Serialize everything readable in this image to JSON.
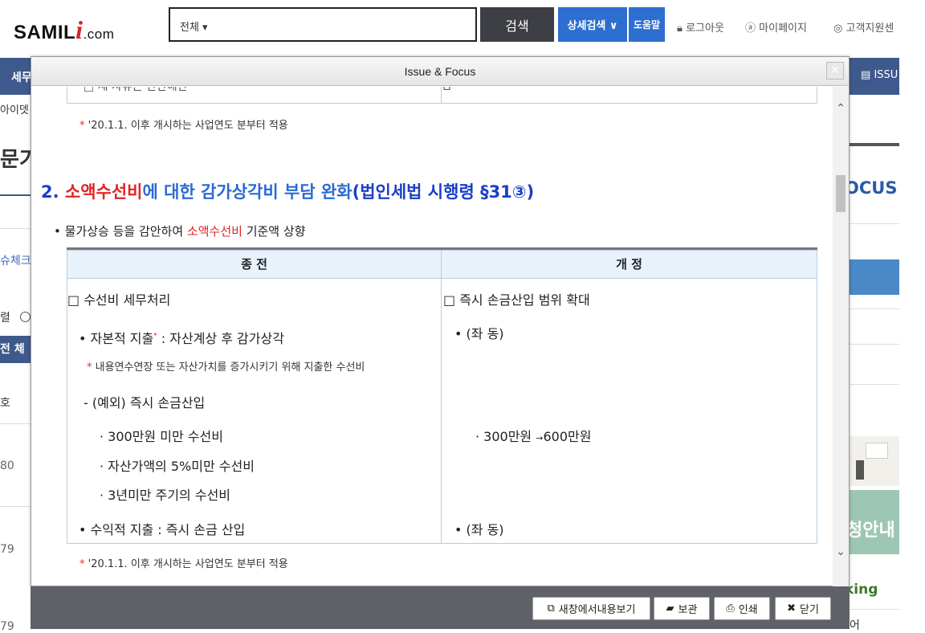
{
  "header": {
    "logo_main": "SAMIL",
    "logo_i": "i",
    "logo_dot": ".com",
    "scope": "전체 ▾",
    "search_label": "검색",
    "advanced_label": "상세검색 ∨",
    "help_label": "도움말",
    "links": [
      "로그아웃",
      "마이페이지",
      "고객지원센"
    ]
  },
  "nav": {
    "left_label": "세무",
    "right_label": "ISSU"
  },
  "background": {
    "t1": "아이뎃",
    "t2": "문기",
    "t3": "슈체크",
    "t4": "렬",
    "t5": "전 체",
    "t6": "호",
    "n1": "80",
    "n2": "79",
    "n3": "79",
    "r1": "OCUS",
    "r2": "청안내",
    "r3": "king",
    "r4": "어"
  },
  "modal": {
    "title": "Issue & Focus",
    "close": "✕",
    "top_note_star": "*",
    "top_note": " '20.1.1. 이후 개시하는 사업연도 분부터 적용",
    "top_row_left": "□ 세 사유는 단만해만",
    "section_num": "2. ",
    "section_red": "소액수선비",
    "section_mid": "에 대한 감가상각비 부담 완화",
    "section_paren": "(법인세법 시행령 §31③)",
    "bullet_pre": "•  물가상승 등을 감안하여 ",
    "bullet_red": "소액수선비",
    "bullet_post": " 기준액 상향",
    "col_before": "종 전",
    "col_after": "개 정",
    "left": {
      "l1": "□ 수선비 세무처리",
      "l2": "•  자본적 지출",
      "l2_star": "*",
      "l2_post": " : 자산계상 후 감가상각",
      "l3_star": "*",
      "l3": " 내용연수연장 또는 자산가치를 증가시키기 위해 지출한 수선비",
      "l4": "- (예외) 즉시 손금산입",
      "l5": "· 300만원 미만 수선비",
      "l6": "· 자산가액의 5%미만 수선비",
      "l7": "· 3년미만 주기의 수선비",
      "l8": "•  수익적 지출 : 즉시 손금 산입"
    },
    "right": {
      "r1": "□ 즉시 손금산입 범위 확대",
      "r2": "•  (좌 동)",
      "r3a": "· 300만원 ",
      "r3arrow": "→",
      "r3b": "600만원",
      "r4": "•  (좌 동)"
    },
    "bottom_note_star": "*",
    "bottom_note": " '20.1.1. 이후 개시하는 사업연도 분부터 적용"
  },
  "footer": {
    "new_window": "새창에서내용보기",
    "save": "보관",
    "print": "인쇄",
    "close": "닫기"
  }
}
